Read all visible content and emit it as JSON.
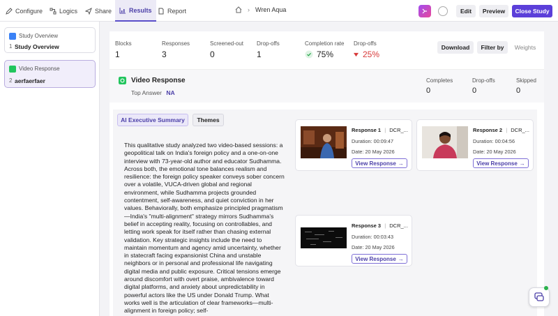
{
  "topnav": {
    "items": [
      {
        "label": "Configure",
        "icon": "pencil-icon"
      },
      {
        "label": "Logics",
        "icon": "logic-icon"
      },
      {
        "label": "Share",
        "icon": "send-icon"
      },
      {
        "label": "Results",
        "icon": "chart-icon",
        "active": true
      },
      {
        "label": "Report",
        "icon": "document-icon"
      }
    ],
    "breadcrumb": {
      "home_icon": "home-icon",
      "separator": "›",
      "study_name": "Wren Aqua"
    },
    "edit_label": "Edit",
    "preview_label": "Preview",
    "close_label": "Close Study",
    "accent": "#5b3fd9"
  },
  "sidebar": {
    "items": [
      {
        "type": "Study Overview",
        "num": "1",
        "name": "Study Overview",
        "badge_color": "#3b82f6"
      },
      {
        "type": "Video Response",
        "num": "2",
        "name": "aerfaerfaer",
        "badge_color": "#22c55e",
        "selected": true
      }
    ]
  },
  "stats": [
    {
      "label": "Blocks",
      "value": "1"
    },
    {
      "label": "Responses",
      "value": "3"
    },
    {
      "label": "Screened-out",
      "value": "0"
    },
    {
      "label": "Drop-offs",
      "value": "1"
    },
    {
      "label": "Completion rate",
      "value": "75%",
      "color": "#22a447"
    },
    {
      "label": "Drop-offs",
      "value": "25%",
      "color": "#d83a3a"
    }
  ],
  "actions": {
    "download": "Download",
    "filter": "Filter by",
    "weights": "Weights"
  },
  "question": {
    "title": "Video Response",
    "top_answer_label": "Top Answer",
    "top_answer_value": "NA",
    "stats": [
      {
        "label": "Completes",
        "value": "0"
      },
      {
        "label": "Drop-offs",
        "value": "0"
      },
      {
        "label": "Skipped",
        "value": "0"
      }
    ]
  },
  "tabs": {
    "summary": "AI Executive Summary",
    "themes": "Themes"
  },
  "summary_text": "This qualitative study analyzed two video-based sessions: a geopolitical talk on India's foreign policy and a one-on-one interview with 73-year-old author and educator Sudhamma. Across both, the emotional tone balances realism and resilience: the foreign policy speaker conveys sober concern over a volatile, VUCA-driven global and regional environment, while Sudhamma projects grounded contentment, self-awareness, and quiet conviction in her values. Behaviorally, both emphasize principled pragmatism—India's \"multi-alignment\" strategy mirrors Sudhamma's belief in accepting reality, focusing on controllables, and letting work speak for itself rather than chasing external validation. Key strategic insights include the need to maintain momentum and agency amid uncertainty, whether in statecraft facing expansionist China and unstable neighbors or in personal and professional life navigating digital media and public exposure. Critical tensions emerge around discomfort with overt praise, ambivalence toward digital platforms, and anxiety about unpredictability in powerful actors like the US under Donald Trump. What works well is the articulation of clear frameworks—multi-alignment in foreign policy; self-",
  "responses": [
    {
      "title": "Response 1",
      "id": "DCR_...",
      "duration": "Duration: 00:09:47",
      "date": "Date: 20 May 2026",
      "button": "View Response"
    },
    {
      "title": "Response 2",
      "id": "DCR_...",
      "duration": "Duration: 00:04:56",
      "date": "Date: 20 May 2026",
      "button": "View Response"
    },
    {
      "title": "Response 3",
      "id": "DCR_...",
      "duration": "Duration: 00:03:43",
      "date": "Date: 20 May 2026",
      "button": "View Response"
    }
  ]
}
